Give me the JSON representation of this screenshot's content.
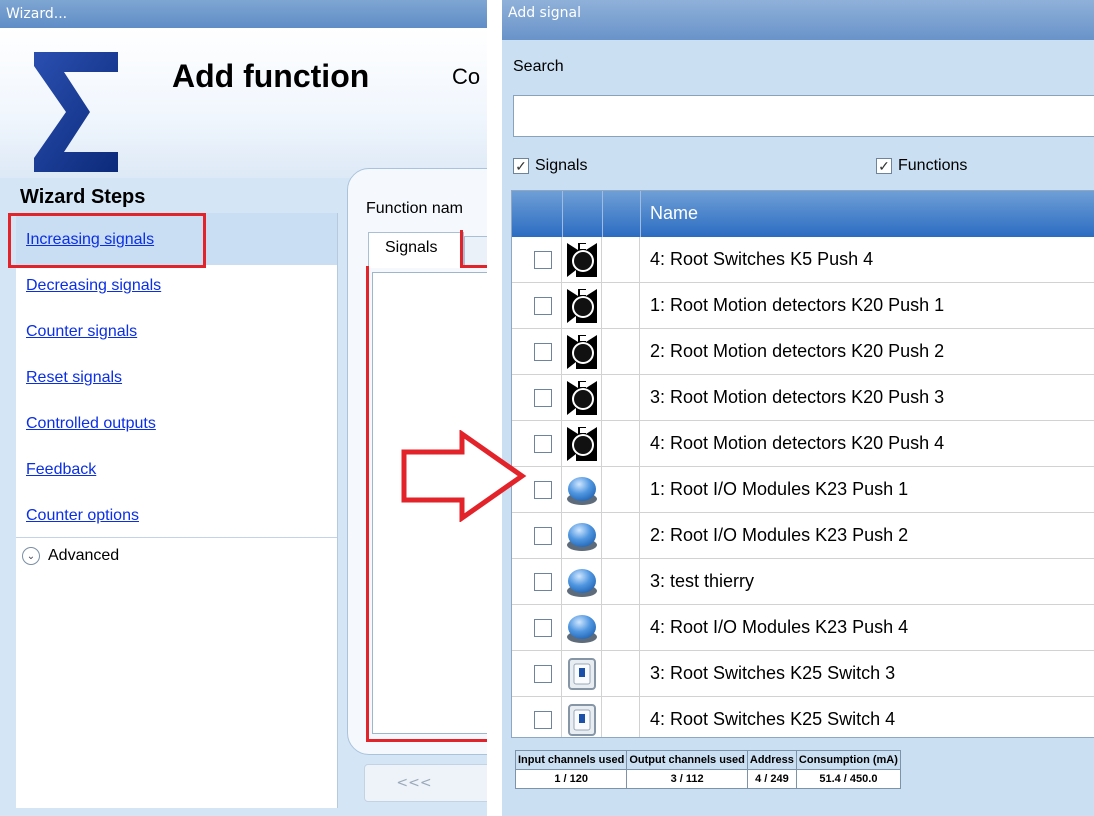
{
  "wizard": {
    "window_title": "Wizard...",
    "page_title": "Add function",
    "page_title_cut": "Co",
    "steps_title": "Wizard Steps",
    "steps": [
      "Increasing signals",
      "Decreasing signals",
      "Counter signals",
      "Reset signals",
      "Controlled outputs",
      "Feedback",
      "Counter options"
    ],
    "advanced_label": "Advanced",
    "function_name_label": "Function nam",
    "tab_signals": "Signals",
    "nav_button": "<<<"
  },
  "add_signal": {
    "window_title": "Add signal",
    "search_label": "Search",
    "search_value": "",
    "filter_signals": "Signals",
    "filter_functions": "Functions",
    "column_name": "Name",
    "rows": [
      {
        "name": "4: Root Switches K5 Push 4",
        "icon": "motion-detector-icon"
      },
      {
        "name": "1: Root Motion detectors K20 Push 1",
        "icon": "motion-detector-icon"
      },
      {
        "name": "2: Root Motion detectors K20 Push 2",
        "icon": "motion-detector-icon"
      },
      {
        "name": "3: Root Motion detectors K20 Push 3",
        "icon": "motion-detector-icon"
      },
      {
        "name": "4: Root Motion detectors K20 Push 4",
        "icon": "motion-detector-icon"
      },
      {
        "name": "1: Root I/O Modules K23 Push 1",
        "icon": "blue-pushbutton-icon"
      },
      {
        "name": "2: Root I/O Modules K23 Push 2",
        "icon": "blue-pushbutton-icon"
      },
      {
        "name": "3: test thierry",
        "icon": "blue-pushbutton-icon"
      },
      {
        "name": "4: Root I/O Modules K23 Push 4",
        "icon": "blue-pushbutton-icon"
      },
      {
        "name": "3: Root Switches K25 Switch 3",
        "icon": "wall-switch-icon"
      },
      {
        "name": "4: Root Switches K25 Switch 4",
        "icon": "wall-switch-icon"
      }
    ],
    "status": {
      "headers": [
        "Input channels used",
        "Output channels used",
        "Address",
        "Consumption (mA)"
      ],
      "values": [
        "1 / 120",
        "3 / 112",
        "4 / 249",
        "51.4 / 450.0"
      ]
    }
  },
  "colors": {
    "accent_red": "#e3232a",
    "link_blue": "#0a2ee6",
    "grid_header_blue": "#2b6cc2"
  }
}
